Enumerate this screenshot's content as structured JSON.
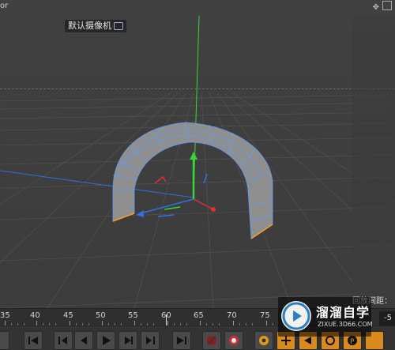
{
  "viewport": {
    "title": "or",
    "camera_label": "默认摄像机",
    "camera_icon": "camera-icon",
    "move_icon": "move-icon",
    "maximize_icon": "maximize-icon",
    "record_distance_label": "回放间距："
  },
  "timeline": {
    "ticks": [
      "35",
      "40",
      "45",
      "50",
      "55",
      "60",
      "65",
      "70",
      "75"
    ],
    "current_frame_field": "-5"
  },
  "controls": {
    "icons": [
      "go-to-start-icon",
      "previous-key-icon",
      "step-back-icon",
      "play-icon",
      "step-forward-icon",
      "next-key-icon",
      "go-to-end-icon",
      "record-off-icon",
      "autokey-icon",
      "settings-icon",
      "move-tool-icon",
      "rotate-tool-icon",
      "scale-tool-icon",
      "parameter-icon"
    ]
  },
  "watermark": {
    "name": "溜溜自学",
    "url": "ZIXUE.3D66.COM"
  },
  "colors": {
    "object_fill": "#8c8c8c",
    "object_wire": "#5aa0ff",
    "axis_y": "#3ad43a",
    "axis_x": "#e03030",
    "axis_z": "#3070e0",
    "selected_edge": "#f0a030"
  }
}
